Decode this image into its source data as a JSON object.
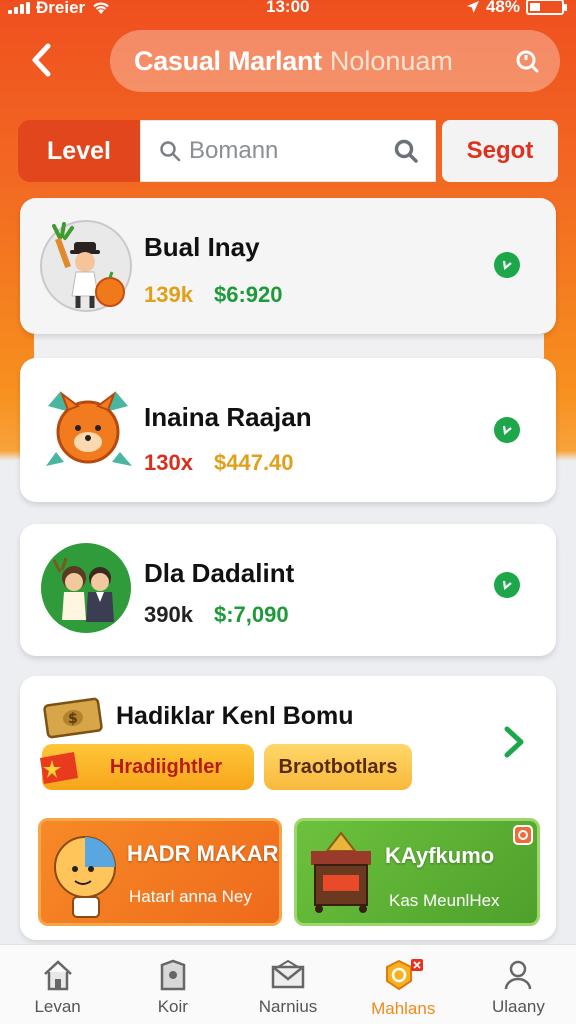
{
  "status_bar": {
    "carrier": "Ðreier",
    "time": "13:00",
    "battery": "48%"
  },
  "header": {
    "title": "Casual Marlant",
    "title_suffix": "Nolonuam"
  },
  "filters": {
    "level_label": "Level",
    "search_placeholder": "Bomann",
    "sort_label": "Segot"
  },
  "players": [
    {
      "name": "Bual Inay",
      "count": "139k",
      "amount": "$6:920",
      "count_color": "#e2a01a",
      "amount_color": "#1e9a3a"
    },
    {
      "name": "Inaina Raajan",
      "count": "130x",
      "amount": "$447.40",
      "count_color": "#d8301e",
      "amount_color": "#e2a01a"
    },
    {
      "name": "Dla Dadalint",
      "count": "390k",
      "amount": "$:7,090",
      "count_color": "#222222",
      "amount_color": "#1e9a3a"
    }
  ],
  "bonus": {
    "title": "Hadiklar Kenl Bomu",
    "tag1": "Hradiightler",
    "tag2": "Braotbotlars",
    "promo1": {
      "title": "HADR MAKAR",
      "subtitle": "Hatarl anna Ney"
    },
    "promo2": {
      "title": "KAyfkumo",
      "subtitle": "Kas MeunlHex"
    }
  },
  "nav": [
    {
      "label": "Levan",
      "icon": "home-icon"
    },
    {
      "label": "Koir",
      "icon": "bag-icon"
    },
    {
      "label": "Narnius",
      "icon": "mail-icon"
    },
    {
      "label": "Mahlans",
      "icon": "coin-icon",
      "active": true
    },
    {
      "label": "Ulaany",
      "icon": "profile-icon"
    }
  ],
  "colors": {
    "primary": "#ef5a1f",
    "accent": "#f08a1c",
    "green": "#1ea74a"
  }
}
